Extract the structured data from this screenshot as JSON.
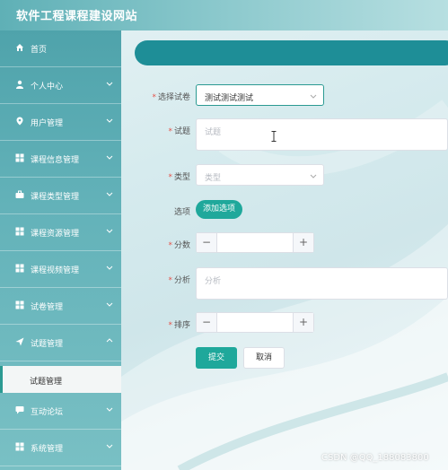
{
  "site": {
    "title": "软件工程课程建设网站"
  },
  "sidebar": {
    "items": [
      {
        "label": "首页",
        "icon": "home-icon"
      },
      {
        "label": "个人中心",
        "icon": "user-icon"
      },
      {
        "label": "用户管理",
        "icon": "location-icon"
      },
      {
        "label": "课程信息管理",
        "icon": "grid-icon"
      },
      {
        "label": "课程类型管理",
        "icon": "briefcase-icon"
      },
      {
        "label": "课程资源管理",
        "icon": "grid-icon"
      },
      {
        "label": "课程视频管理",
        "icon": "grid-icon"
      },
      {
        "label": "试卷管理",
        "icon": "grid-icon"
      },
      {
        "label": "试题管理",
        "icon": "send-icon"
      },
      {
        "label": "互动论坛",
        "icon": "chat-icon"
      },
      {
        "label": "系统管理",
        "icon": "grid-icon"
      }
    ],
    "submenu": {
      "label": "试题管理"
    }
  },
  "form": {
    "paper": {
      "label": "选择试卷",
      "value": "测试测试测试"
    },
    "question": {
      "label": "试题",
      "placeholder": "试题"
    },
    "type": {
      "label": "类型",
      "placeholder": "类型"
    },
    "options": {
      "label": "选项",
      "button": "添加选项"
    },
    "score": {
      "label": "分数",
      "minus": "−",
      "plus": "+"
    },
    "analysis": {
      "label": "分析",
      "placeholder": "分析"
    },
    "order": {
      "label": "排序",
      "minus": "−",
      "plus": "+"
    },
    "required_mark": "*",
    "submit": "提交",
    "cancel": "取消"
  },
  "watermark": "CSDN @QQ_188083800",
  "colors": {
    "accent": "#1fa89b",
    "header_bar": "#1e8e97",
    "sidebar": "#5fb0b6",
    "required": "#e5534b"
  }
}
